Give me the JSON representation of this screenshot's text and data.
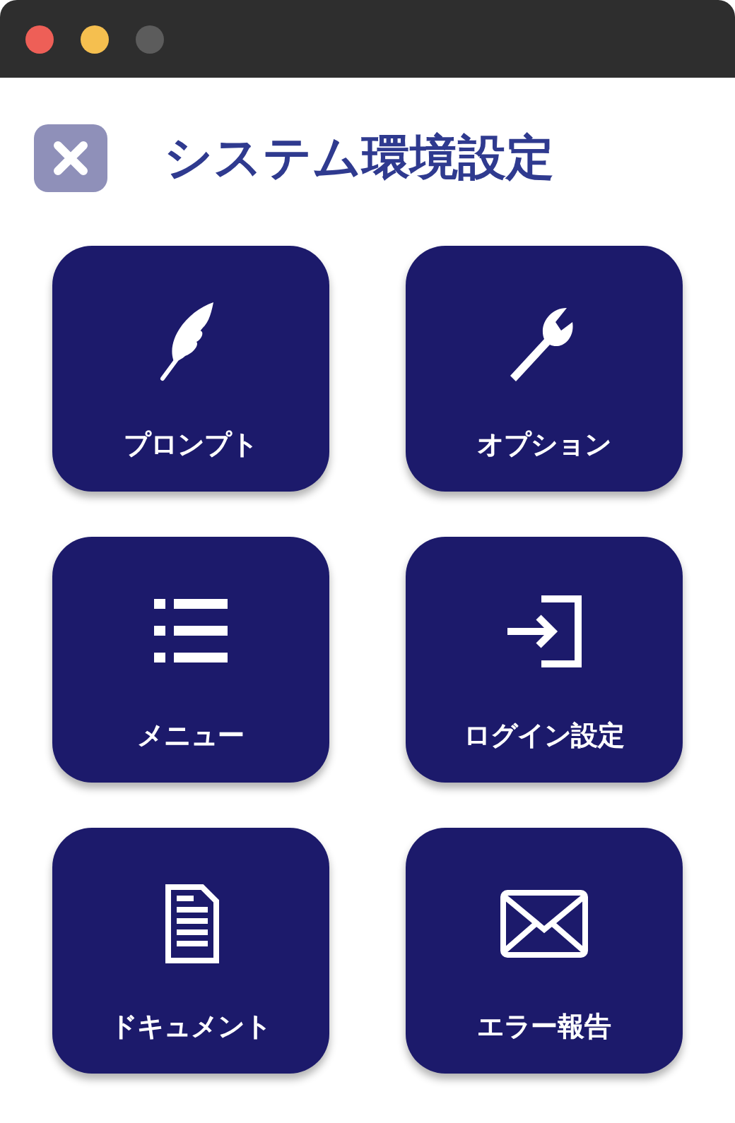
{
  "header": {
    "title": "システム環境設定"
  },
  "tiles": [
    {
      "label": "プロンプト",
      "kind": "feather"
    },
    {
      "label": "オプション",
      "kind": "wrench"
    },
    {
      "label": "メニュー",
      "kind": "list"
    },
    {
      "label": "ログイン設定",
      "kind": "login"
    },
    {
      "label": "ドキュメント",
      "kind": "document"
    },
    {
      "label": "エラー報告",
      "kind": "envelope"
    }
  ]
}
